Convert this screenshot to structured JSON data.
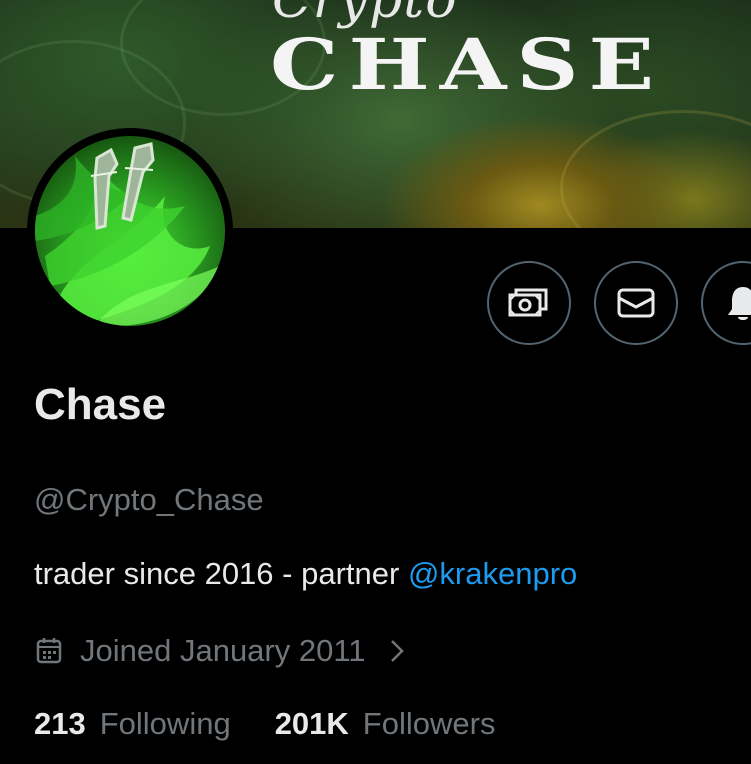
{
  "banner": {
    "script_text": "Crypto",
    "title_text": "CHASE"
  },
  "profile": {
    "display_name": "Chase",
    "handle": "@Crypto_Chase",
    "bio_text": "trader since 2016 - partner ",
    "bio_link": "@krakenpro",
    "joined": "Joined January 2011",
    "following_count": "213",
    "following_label": "Following",
    "followers_count": "201K",
    "followers_label": "Followers"
  },
  "actions": [
    {
      "name": "tip-button",
      "icon": "money-icon"
    },
    {
      "name": "message-button",
      "icon": "mail-icon"
    },
    {
      "name": "notifications-button",
      "icon": "bell-icon"
    }
  ],
  "colors": {
    "background": "#000000",
    "primary_text": "#e7e9ea",
    "secondary_text": "#71767b",
    "link": "#1d9bf0",
    "button_border": "#536471",
    "avatar_green": "#3ccc2c"
  }
}
